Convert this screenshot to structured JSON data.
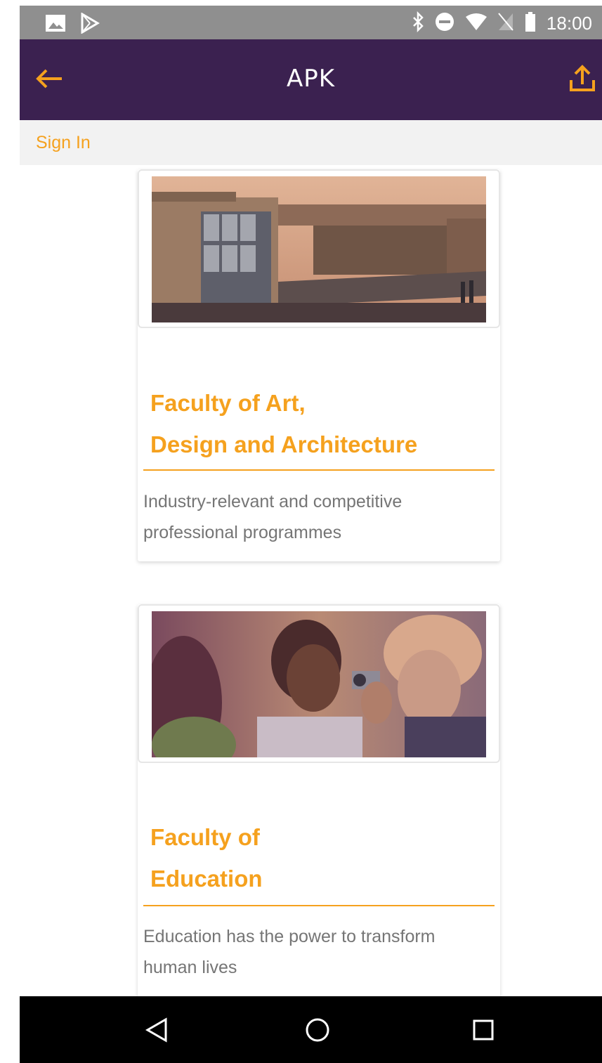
{
  "status_bar": {
    "time": "18:00",
    "left_icons": [
      "image-icon",
      "play-store-icon"
    ],
    "right_icons": [
      "bluetooth-icon",
      "do-not-disturb-icon",
      "wifi-icon",
      "no-sim-icon",
      "battery-icon"
    ]
  },
  "app_bar": {
    "title": "APK",
    "back_icon": "arrow-left-icon",
    "share_icon": "share-upload-icon",
    "background": "#3b2150",
    "accent": "#f5a11e"
  },
  "signin": {
    "label": "Sign In"
  },
  "cards": [
    {
      "title_line1": "Faculty of Art,",
      "title_line2": "Design and Architecture",
      "description": "Industry-relevant and competitive professional programmes"
    },
    {
      "title_line1": "Faculty of",
      "title_line2": "Education",
      "description": "Education has the power to transform human lives"
    }
  ],
  "nav_bar": {
    "icons": [
      "back-triangle-icon",
      "home-circle-icon",
      "recents-square-icon"
    ]
  }
}
